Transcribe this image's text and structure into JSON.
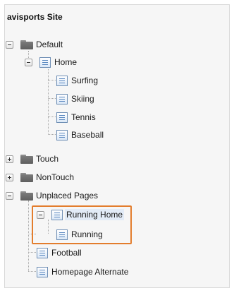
{
  "tree": {
    "site_title": "avisports Site",
    "default": {
      "label": "Default",
      "home": {
        "label": "Home",
        "children": [
          "Surfing",
          "Skiing",
          "Tennis",
          "Baseball"
        ]
      }
    },
    "touch": {
      "label": "Touch"
    },
    "nontouch": {
      "label": "NonTouch"
    },
    "unplaced": {
      "label": "Unplaced Pages",
      "running_home": {
        "label": "Running Home",
        "children": [
          "Running"
        ]
      },
      "pages": [
        "Football",
        "Homepage Alternate"
      ]
    }
  },
  "colors": {
    "highlight": "#e37d2d",
    "selection": "#e2ebf7"
  }
}
